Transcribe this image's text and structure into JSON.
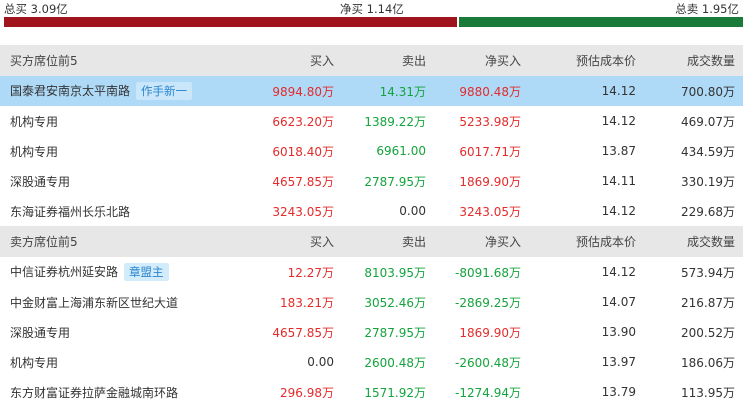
{
  "summary": {
    "total_buy": "总买 3.09亿",
    "net_buy": "净买 1.14亿",
    "total_sell": "总卖 1.95亿",
    "buy_ratio": 0.613
  },
  "colors": {
    "buy_bar": "#a0141e",
    "sell_bar": "#1a7a3a",
    "positive": "#e42b2b",
    "negative": "#14a33c",
    "highlight_row": "#aed9f7",
    "tag_text": "#2a86cf"
  },
  "buy_section": {
    "headers": [
      "买方席位前5",
      "买入",
      "卖出",
      "净买入",
      "预估成本价",
      "成交数量"
    ],
    "rows": [
      {
        "name": "国泰君安南京太平南路",
        "tag": "作手新一",
        "buy": "9894.80万",
        "sell": "14.31万",
        "net": "9880.48万",
        "cost": "14.12",
        "volume": "700.80万",
        "buy_color": "red",
        "sell_color": "green",
        "net_color": "red"
      },
      {
        "name": "机构专用",
        "tag": "",
        "buy": "6623.20万",
        "sell": "1389.22万",
        "net": "5233.98万",
        "cost": "14.12",
        "volume": "469.07万",
        "buy_color": "red",
        "sell_color": "green",
        "net_color": "red"
      },
      {
        "name": "机构专用",
        "tag": "",
        "buy": "6018.40万",
        "sell": "6961.00",
        "net": "6017.71万",
        "cost": "13.87",
        "volume": "434.59万",
        "buy_color": "red",
        "sell_color": "green",
        "net_color": "red"
      },
      {
        "name": "深股通专用",
        "tag": "",
        "buy": "4657.85万",
        "sell": "2787.95万",
        "net": "1869.90万",
        "cost": "14.11",
        "volume": "330.19万",
        "buy_color": "red",
        "sell_color": "green",
        "net_color": "red"
      },
      {
        "name": "东海证券福州长乐北路",
        "tag": "",
        "buy": "3243.05万",
        "sell": "0.00",
        "net": "3243.05万",
        "cost": "14.12",
        "volume": "229.68万",
        "buy_color": "red",
        "sell_color": "black",
        "net_color": "red"
      }
    ]
  },
  "sell_section": {
    "headers": [
      "卖方席位前5",
      "买入",
      "卖出",
      "净买入",
      "预估成本价",
      "成交数量"
    ],
    "rows": [
      {
        "name": "中信证券杭州延安路",
        "tag": "章盟主",
        "buy": "12.27万",
        "sell": "8103.95万",
        "net": "-8091.68万",
        "cost": "14.12",
        "volume": "573.94万",
        "buy_color": "red",
        "sell_color": "green",
        "net_color": "green"
      },
      {
        "name": "中金财富上海浦东新区世纪大道",
        "tag": "",
        "buy": "183.21万",
        "sell": "3052.46万",
        "net": "-2869.25万",
        "cost": "14.07",
        "volume": "216.87万",
        "buy_color": "red",
        "sell_color": "green",
        "net_color": "green"
      },
      {
        "name": "深股通专用",
        "tag": "",
        "buy": "4657.85万",
        "sell": "2787.95万",
        "net": "1869.90万",
        "cost": "13.90",
        "volume": "200.52万",
        "buy_color": "red",
        "sell_color": "green",
        "net_color": "red"
      },
      {
        "name": "机构专用",
        "tag": "",
        "buy": "0.00",
        "sell": "2600.48万",
        "net": "-2600.48万",
        "cost": "13.97",
        "volume": "186.06万",
        "buy_color": "black",
        "sell_color": "green",
        "net_color": "green"
      },
      {
        "name": "东方财富证券拉萨金融城南环路",
        "tag": "",
        "buy": "296.98万",
        "sell": "1571.92万",
        "net": "-1274.94万",
        "cost": "13.79",
        "volume": "113.95万",
        "buy_color": "red",
        "sell_color": "green",
        "net_color": "green"
      }
    ]
  }
}
